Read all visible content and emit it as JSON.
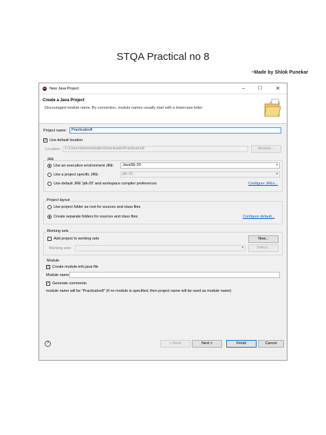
{
  "document": {
    "title": "STQA Practical no 8",
    "author": "~Made by Shlok Punekar"
  },
  "window": {
    "title": "New Java Project",
    "minimize": "–",
    "maximize": "☐",
    "close": "✕"
  },
  "banner": {
    "title": "Create a Java Project",
    "description": "Discouraged module name. By convention, module names usually start with a lowercase letter"
  },
  "project": {
    "name_label": "Project name:",
    "name_value": "Practicalno8",
    "use_default_location_label": "Use default location",
    "use_default_location_checked": true,
    "location_label": "Location:",
    "location_value": "C:\\Users\\Administrator\\Downloads\\Practicalno8",
    "browse_label": "Browse..."
  },
  "jre": {
    "group_title": "JRE",
    "options": [
      {
        "label": "Use an execution environment JRE:",
        "selected": true,
        "value": "JavaSE-20"
      },
      {
        "label": "Use a project specific JRE:",
        "selected": false,
        "value": "jdk-20"
      },
      {
        "label": "Use default JRE 'jdk-20' and workspace compiler preferences",
        "selected": false
      }
    ],
    "configure_link": "Configure JREs..."
  },
  "layout": {
    "group_title": "Project layout",
    "options": [
      {
        "label": "Use project folder as root for sources and class files",
        "selected": false
      },
      {
        "label": "Create separate folders for sources and class files",
        "selected": true
      }
    ],
    "configure_link": "Configure default..."
  },
  "working_sets": {
    "group_title": "Working sets",
    "add_label": "Add project to working sets",
    "add_checked": false,
    "new_button": "New...",
    "ws_label": "Working sets:",
    "select_button": "Select..."
  },
  "module": {
    "group_title": "Module",
    "create_label": "Create module-info.java file",
    "create_checked": true,
    "name_label": "Module name:",
    "name_value": "",
    "generate_label": "Generate comments",
    "generate_checked": true,
    "note": "module name will be \"Practicalno8\" (if no module is specified, then project name will be used as module name)"
  },
  "footer": {
    "help": "?",
    "back": "< Back",
    "next": "Next >",
    "finish": "Finish",
    "cancel": "Cancel"
  },
  "colors": {
    "accent": "#0078d7",
    "link": "#0b57d0"
  }
}
